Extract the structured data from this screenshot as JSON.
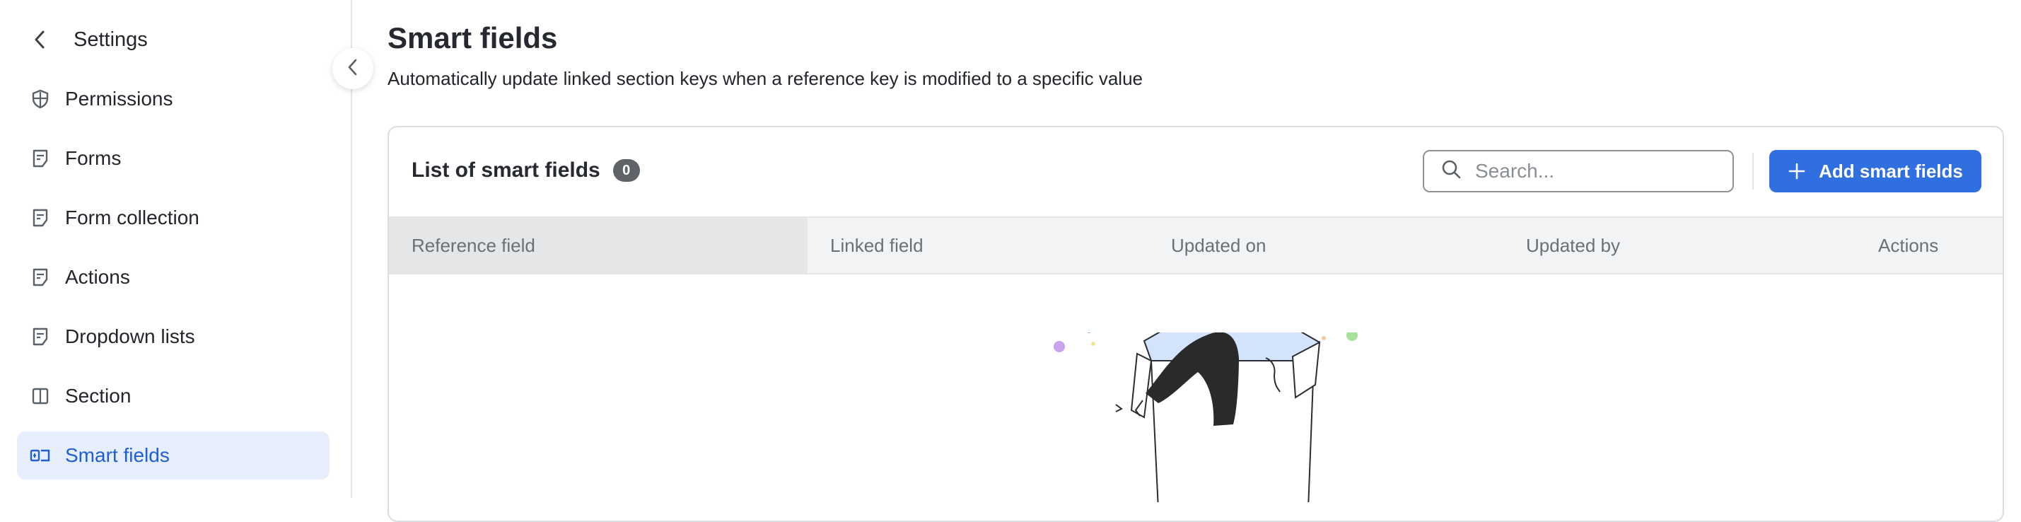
{
  "sidebar": {
    "header_title": "Settings",
    "items": [
      {
        "label": "Permissions",
        "icon": "shield-icon"
      },
      {
        "label": "Forms",
        "icon": "form-icon"
      },
      {
        "label": "Form collection",
        "icon": "form-icon"
      },
      {
        "label": "Actions",
        "icon": "form-icon"
      },
      {
        "label": "Dropdown lists",
        "icon": "form-icon"
      },
      {
        "label": "Section",
        "icon": "columns-icon"
      },
      {
        "label": "Smart fields",
        "icon": "smart-field-icon",
        "active": true
      }
    ]
  },
  "page": {
    "title": "Smart fields",
    "subtitle": "Automatically update linked section keys when a reference key is modified to a specific value"
  },
  "card": {
    "title": "List of smart fields",
    "count": "0",
    "search_placeholder": "Search...",
    "add_button_label": "Add smart fields",
    "columns": [
      "Reference field",
      "Linked field",
      "Updated on",
      "Updated by",
      "Actions"
    ]
  },
  "colors": {
    "accent": "#2f6fe0",
    "active_bg": "#e6eefb",
    "active_text": "#1f5fd1"
  }
}
